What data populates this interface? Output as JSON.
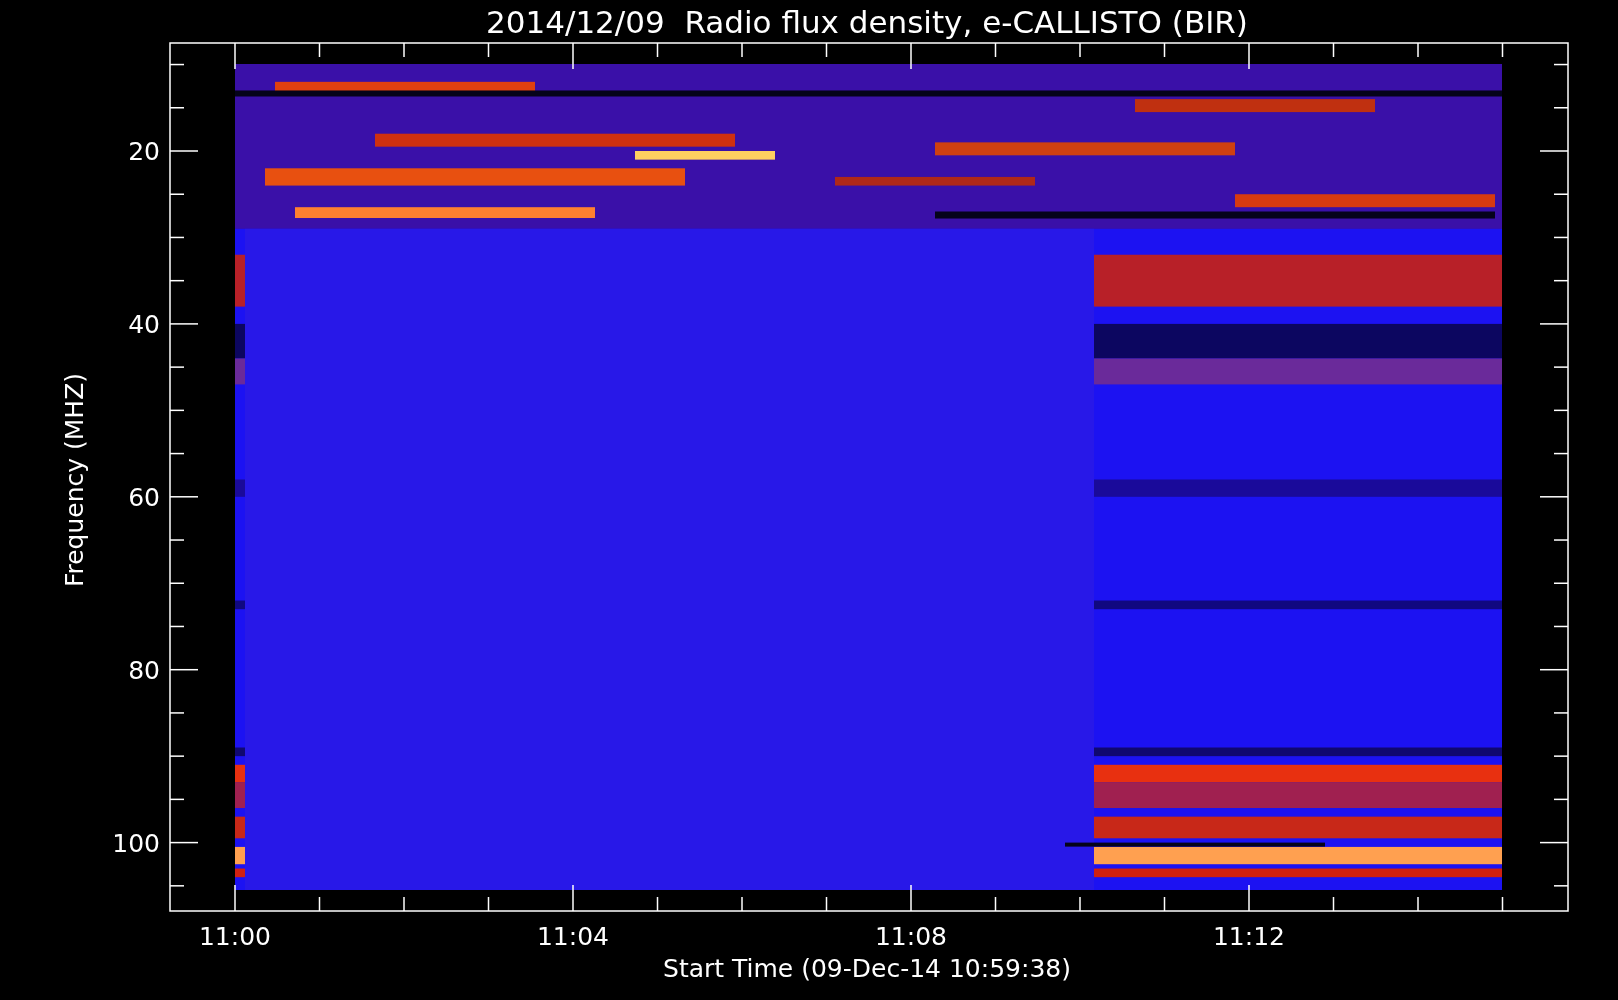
{
  "plot": {
    "title": "2014/12/09  Radio flux density, e-CALLISTO (BIR)",
    "ylabel": "Frequency (MHZ)",
    "xlabel": "Start Time (09-Dec-14 10:59:38)",
    "yticks": [
      "20",
      "40",
      "60",
      "80",
      "100"
    ],
    "xticks": [
      "11:00",
      "11:04",
      "11:08",
      "11:12"
    ],
    "picture": {
      "kind": "picture"
    }
  }
}
